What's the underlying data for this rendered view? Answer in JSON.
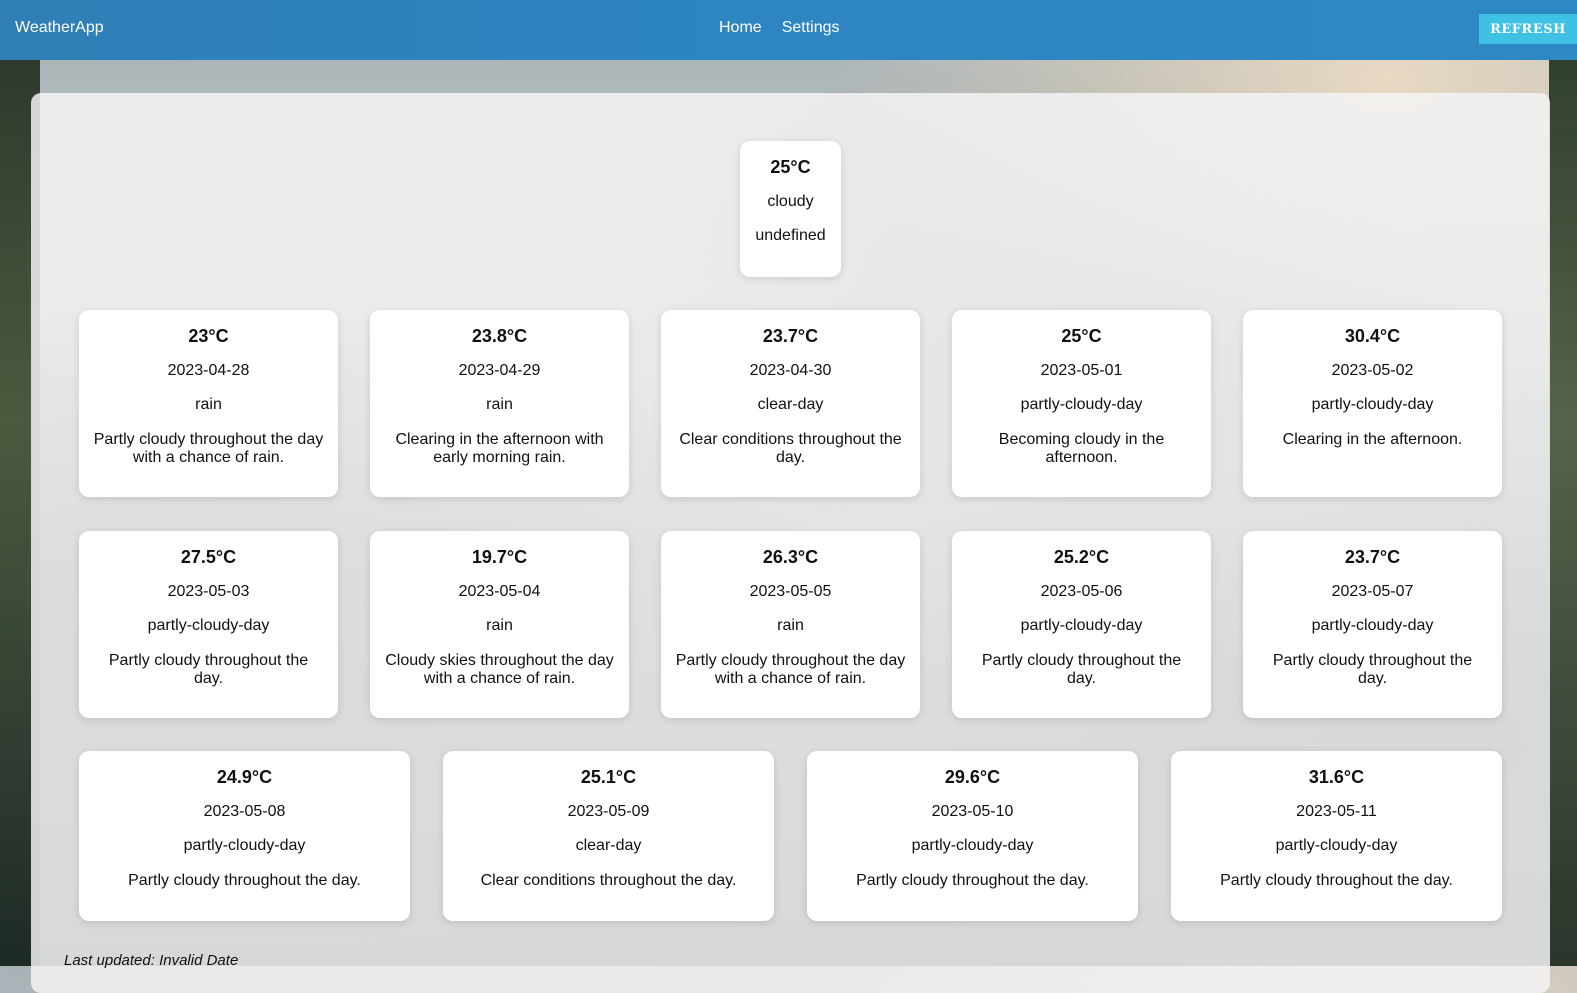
{
  "header": {
    "brand": "WeatherApp",
    "nav": [
      "Home",
      "Settings"
    ],
    "refresh_label": "REFRESH"
  },
  "current": {
    "temp": "25°C",
    "condition": "cloudy",
    "extra": "undefined"
  },
  "forecast": [
    {
      "temp": "23°C",
      "date": "2023-04-28",
      "icon": "rain",
      "desc": "Partly cloudy throughout the day with a chance of rain."
    },
    {
      "temp": "23.8°C",
      "date": "2023-04-29",
      "icon": "rain",
      "desc": "Clearing in the afternoon with early morning rain."
    },
    {
      "temp": "23.7°C",
      "date": "2023-04-30",
      "icon": "clear-day",
      "desc": "Clear conditions throughout the day."
    },
    {
      "temp": "25°C",
      "date": "2023-05-01",
      "icon": "partly-cloudy-day",
      "desc": "Becoming cloudy in the afternoon."
    },
    {
      "temp": "30.4°C",
      "date": "2023-05-02",
      "icon": "partly-cloudy-day",
      "desc": "Clearing in the afternoon."
    },
    {
      "temp": "27.5°C",
      "date": "2023-05-03",
      "icon": "partly-cloudy-day",
      "desc": "Partly cloudy throughout the day."
    },
    {
      "temp": "19.7°C",
      "date": "2023-05-04",
      "icon": "rain",
      "desc": "Cloudy skies throughout the day with a chance of rain."
    },
    {
      "temp": "26.3°C",
      "date": "2023-05-05",
      "icon": "rain",
      "desc": "Partly cloudy throughout the day with a chance of rain."
    },
    {
      "temp": "25.2°C",
      "date": "2023-05-06",
      "icon": "partly-cloudy-day",
      "desc": "Partly cloudy throughout the day."
    },
    {
      "temp": "23.7°C",
      "date": "2023-05-07",
      "icon": "partly-cloudy-day",
      "desc": "Partly cloudy throughout the day."
    },
    {
      "temp": "24.9°C",
      "date": "2023-05-08",
      "icon": "partly-cloudy-day",
      "desc": "Partly cloudy throughout the day."
    },
    {
      "temp": "25.1°C",
      "date": "2023-05-09",
      "icon": "clear-day",
      "desc": "Clear conditions throughout the day."
    },
    {
      "temp": "29.6°C",
      "date": "2023-05-10",
      "icon": "partly-cloudy-day",
      "desc": "Partly cloudy throughout the day."
    },
    {
      "temp": "31.6°C",
      "date": "2023-05-11",
      "icon": "partly-cloudy-day",
      "desc": "Partly cloudy throughout the day."
    }
  ],
  "footer": {
    "last_updated": "Last updated: Invalid Date"
  }
}
